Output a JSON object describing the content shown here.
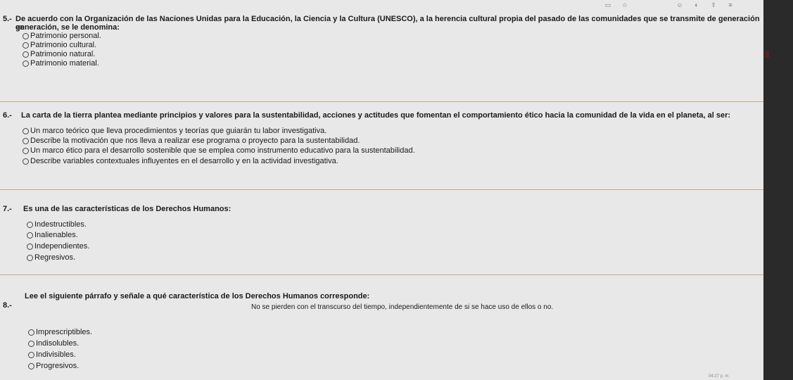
{
  "toolbar": {
    "icons": [
      "tab-icon",
      "star-icon",
      "profile-icon",
      "extension-icon",
      "share-icon",
      "menu-icon"
    ]
  },
  "questions": [
    {
      "number": "5.-",
      "text_line1": "De acuerdo con la Organización de las Naciones Unidas para la Educación, la Ciencia y la Cultura (UNESCO), a la herencia cultural propia del pasado de las comunidades que se transmite de generación en",
      "text_line2": "generación, se le denomina:",
      "options": [
        "Patrimonio personal.",
        "Patrimonio cultural.",
        "Patrimonio natural.",
        "Patrimonio material."
      ]
    },
    {
      "number": "6.-",
      "text_line1": "La carta de la tierra plantea mediante principios y valores para la sustentabilidad, acciones y actitudes que fomentan el comportamiento ético hacia la comunidad de la vida en el planeta, al ser:",
      "options": [
        "Un marco teórico que lleva procedimientos y teorías que guiarán tu labor investigativa.",
        "Describe la motivación que nos lleva a realizar ese programa o proyecto para la sustentabilidad.",
        "Un marco ético para el desarrollo sostenible que se emplea como instrumento educativo para la sustentabilidad.",
        "Describe variables contextuales influyentes en el desarrollo y en la actividad investigativa."
      ]
    },
    {
      "number": "7.-",
      "text_line1": "Es una de las características de los Derechos Humanos:",
      "options": [
        "Indestructibles.",
        "Inalienables.",
        "Independientes.",
        "Regresivos."
      ]
    },
    {
      "number": "8.-",
      "text_line1": "Lee el siguiente párrafo y señale a qué característica de los Derechos Humanos corresponde:",
      "quote": "No se pierden con el transcurso del tiempo, independientemente de si se hace uso de ellos o no.",
      "options": [
        "Imprescriptibles.",
        "Indisolubles.",
        "Indivisibles.",
        "Progresivos."
      ]
    }
  ],
  "clock": "04:27 p. m."
}
